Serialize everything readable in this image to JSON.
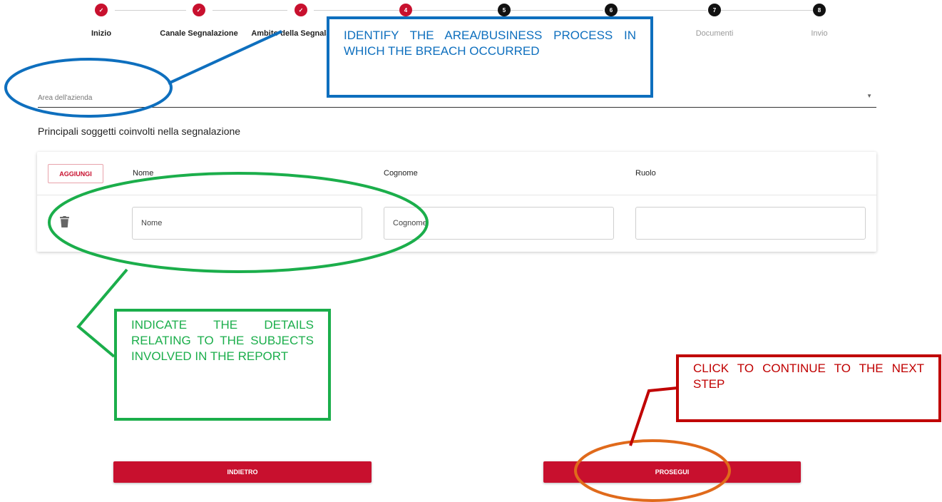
{
  "stepper": {
    "steps": [
      {
        "label": "Inizio",
        "state": "done",
        "mark": "✓"
      },
      {
        "label": "Canale Segnalazione",
        "state": "done",
        "mark": "✓"
      },
      {
        "label": "Ambito della Segnalazione",
        "state": "done",
        "mark": "✓"
      },
      {
        "label": "",
        "state": "active",
        "mark": "4"
      },
      {
        "label": "",
        "state": "todo",
        "mark": "5"
      },
      {
        "label": "",
        "state": "todo",
        "mark": "6"
      },
      {
        "label": "Documenti",
        "state": "todo",
        "mark": "7"
      },
      {
        "label": "Invio",
        "state": "todo",
        "mark": "8"
      }
    ]
  },
  "area": {
    "placeholder": "Area dell'azienda"
  },
  "section": {
    "title": "Principali soggetti coinvolti nella segnalazione"
  },
  "table": {
    "add_label": "AGGIUNGI",
    "columns": [
      "Nome",
      "Cognome",
      "Ruolo"
    ],
    "row": {
      "nome_placeholder": "Nome",
      "cognome_placeholder": "Cognome",
      "ruolo_value": ""
    }
  },
  "buttons": {
    "back": "INDIETRO",
    "next": "PROSEGUI"
  },
  "annotations": {
    "blue": "IDENTIFY THE AREA/BUSINESS PROCESS IN WHICH THE BREACH OCCURRED",
    "green": "INDICATE THE DETAILS RELATING TO THE SUBJECTS INVOLVED IN THE REPORT",
    "red": "CLICK TO CONTINUE TO THE NEXT STEP"
  },
  "colors": {
    "brand": "#c8102e",
    "blue": "#0e6fbe",
    "green": "#1bae4b",
    "red": "#c00000",
    "orange": "#e06a1b"
  },
  "icons": {
    "done": "check-icon",
    "delete": "trash-icon",
    "dropdown": "caret-down-icon"
  }
}
